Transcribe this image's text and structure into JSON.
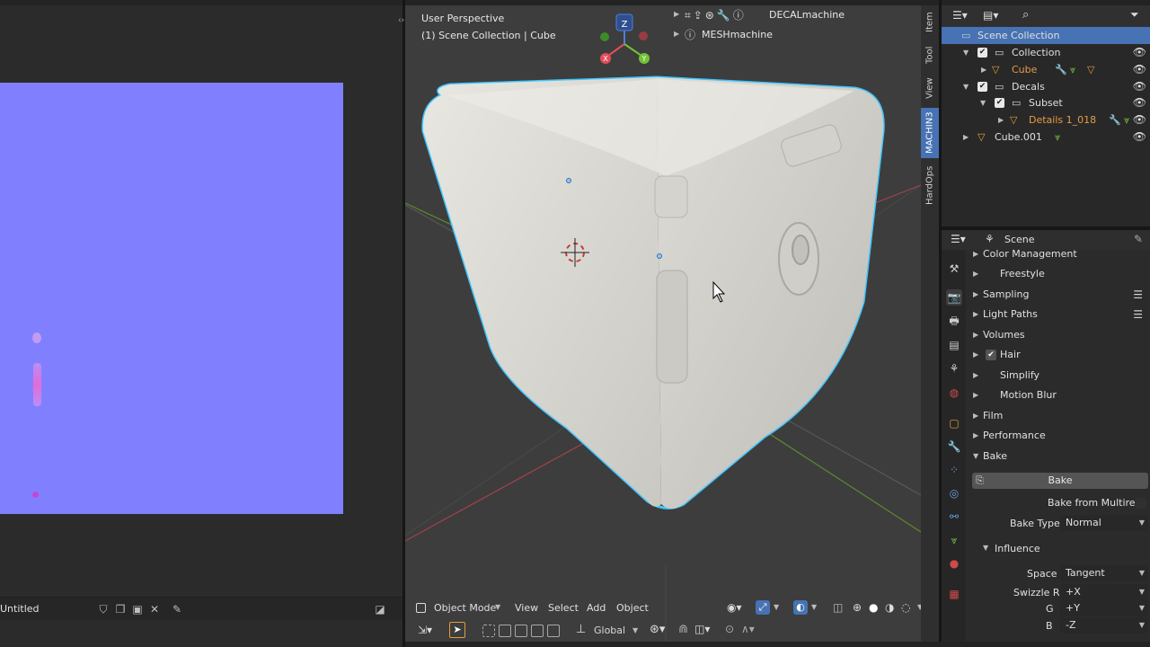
{
  "image_editor": {
    "image_name": "Untitled"
  },
  "viewport": {
    "view_name": "User Perspective",
    "collection_info": "(1) Scene Collection | Cube",
    "panels": [
      {
        "label": "DECALmachine"
      },
      {
        "label": "MESHmachine"
      }
    ],
    "header": {
      "mode": "Object Mode",
      "menu": [
        "View",
        "Select",
        "Add",
        "Object"
      ]
    },
    "tools": {
      "transform_orientation": "Global"
    },
    "axis_colors": {
      "x": "#e44d5b",
      "y": "#72c234",
      "z": "#4c7fe0"
    }
  },
  "npanel_tabs": [
    {
      "label": "Item",
      "active": false
    },
    {
      "label": "Tool",
      "active": false
    },
    {
      "label": "View",
      "active": false
    },
    {
      "label": "MACHIN3",
      "active": true
    },
    {
      "label": "HardOps",
      "active": false
    }
  ],
  "outliner": {
    "rows": [
      {
        "label": "Scene Collection",
        "selected": true
      },
      {
        "label": "Collection"
      },
      {
        "label": "Cube",
        "color": "#e59b44"
      },
      {
        "label": "Decals"
      },
      {
        "label": "Subset"
      },
      {
        "label": "Details 1_018",
        "color": "#e59b44"
      },
      {
        "label": "Cube.001"
      }
    ]
  },
  "properties": {
    "context": "Scene",
    "sections": [
      {
        "label": "Color Management"
      },
      {
        "label": "Freestyle"
      },
      {
        "label": "Sampling"
      },
      {
        "label": "Light Paths"
      },
      {
        "label": "Volumes"
      },
      {
        "label": "Hair",
        "checked": true
      },
      {
        "label": "Simplify"
      },
      {
        "label": "Motion Blur"
      },
      {
        "label": "Film"
      },
      {
        "label": "Performance"
      },
      {
        "label": "Bake"
      }
    ],
    "bake": {
      "button_label": "Bake",
      "multires_label": "Bake from Multires",
      "bake_type_label": "Bake Type",
      "bake_type_value": "Normal",
      "influence_label": "Influence",
      "space_label": "Space",
      "space_value": "Tangent",
      "swizzle_r_label": "Swizzle R",
      "swizzle_r_value": "+X",
      "swizzle_g_label": "G",
      "swizzle_g_value": "+Y",
      "swizzle_b_label": "B",
      "swizzle_b_value": "-Z"
    }
  }
}
